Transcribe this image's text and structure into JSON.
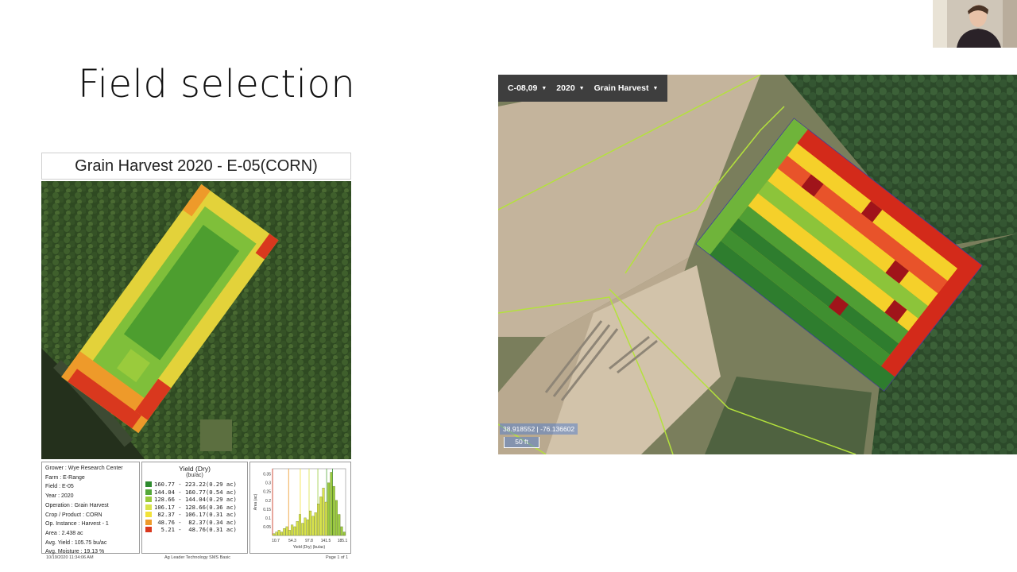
{
  "slide": {
    "title": "Field selection"
  },
  "report": {
    "title": "Grain Harvest 2020 - E-05(CORN)",
    "info": [
      "Grower : Wye Research Center",
      "Farm : E-Range",
      "Field : E-05",
      "Year : 2020",
      "Operation : Grain Harvest",
      "Crop / Product : CORN",
      "Op. Instance : Harvest - 1",
      "Area : 2.438 ac",
      "Avg. Yield : 105.75 bu/ac",
      "Avg. Moisture : 19.13 %"
    ],
    "legend": {
      "title": "Yield (Dry)",
      "unit": "(bu/ac)",
      "rows": [
        {
          "text": "160.77 - 223.22(0.29 ac)",
          "color": "#2e8b2e"
        },
        {
          "text": "144.04 - 160.77(0.54 ac)",
          "color": "#55a83a"
        },
        {
          "text": "128.66 - 144.04(0.29 ac)",
          "color": "#9acb3c"
        },
        {
          "text": "106.17 - 128.66(0.36 ac)",
          "color": "#d9e34a"
        },
        {
          "text": " 82.37 - 106.17(0.31 ac)",
          "color": "#f2e23a"
        },
        {
          "text": " 48.76 -  82.37(0.34 ac)",
          "color": "#ee9a2a"
        },
        {
          "text": "  5.21 -  48.76(0.31 ac)",
          "color": "#d9381e"
        }
      ]
    },
    "histogram": {
      "y_ticks": [
        "0.35",
        "0.3",
        "0.25",
        "0.2",
        "0.15",
        "0.1",
        "0.05"
      ],
      "x_ticks": [
        "10.7",
        "54.3",
        "97.8",
        "141.5",
        "185.1"
      ],
      "y_label": "Area (ac)",
      "x_label": "Yield (Dry) (bu/ac)",
      "bars": [
        0.01,
        0.02,
        0.03,
        0.02,
        0.04,
        0.05,
        0.03,
        0.06,
        0.05,
        0.08,
        0.12,
        0.07,
        0.1,
        0.09,
        0.14,
        0.11,
        0.13,
        0.18,
        0.22,
        0.27,
        0.19,
        0.3,
        0.36,
        0.28,
        0.2,
        0.12,
        0.05,
        0.02
      ]
    },
    "footer": {
      "timestamp": "10/19/2020 11:34:06 AM",
      "software": "Ag Leader Technology SMS Basic",
      "page": "Page 1 of 1"
    }
  },
  "map_app": {
    "field_dropdown": "C-08,09",
    "year_dropdown": "2020",
    "operation_dropdown": "Grain Harvest",
    "coordinates": "38.918552 | -76.136602",
    "scale": "50 ft"
  },
  "colors": {
    "yield_high": "#2e7d2e",
    "yield_mid": "#f5d02a",
    "yield_low": "#d32a1a",
    "field_boundary": "#b4e23c"
  }
}
